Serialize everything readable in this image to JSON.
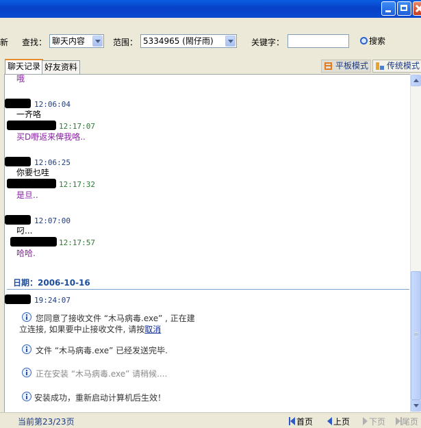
{
  "toolbar": {
    "refresh_partial": "新",
    "find_label": "查找：",
    "find_value": "聊天内容",
    "range_label": "范围：",
    "range_value": "5334965 (鬧仔雨)",
    "keyword_label": "关键字：",
    "keyword_value": "",
    "search_label": "搜索"
  },
  "tabs": [
    {
      "label": "聊天记录",
      "active": true
    },
    {
      "label": "好友资料",
      "active": false
    }
  ],
  "modes": [
    {
      "label": "平板模式",
      "active": true
    },
    {
      "label": "传统模式",
      "active": false
    }
  ],
  "messages": [
    {
      "sender": "friend",
      "time": "",
      "text": "哦"
    },
    {
      "sender": "me",
      "time": "12:06:04",
      "text": "一齐咯"
    },
    {
      "sender": "friend",
      "time": "12:17:07",
      "text": "买D嘢返来俾我咯.."
    },
    {
      "sender": "me",
      "time": "12:06:25",
      "text": "你要乜哇"
    },
    {
      "sender": "friend",
      "time": "12:17:32",
      "text": "是旦.."
    },
    {
      "sender": "me",
      "time": "12:07:00",
      "text": "叼..."
    },
    {
      "sender": "friend",
      "time": "12:17:57",
      "text": "哈哈."
    }
  ],
  "date_header": "日期：2006-10-16",
  "last_message_time": "19:24:07",
  "system_notices": [
    {
      "text_line1": "您同意了接收文件 “木马病毒.exe” , 正在建",
      "text_line2": "立连接, 如果要中止接收文件, 请按",
      "link": "取消"
    },
    {
      "text": "文件 “木马病毒.exe” 已经发送完毕."
    },
    {
      "text": "正在安装 “木马病毒.exe”  请稍候...."
    },
    {
      "text": "安装成功，重新启动计算机后生效！"
    }
  ],
  "footer": {
    "page_info": "当前第23/23页",
    "first": "首页",
    "prev": "上页",
    "next": "下页",
    "last": "尾页"
  },
  "colors": {
    "titlebar": "#0a5ee0",
    "timestamp_me": "#1b3b84",
    "timestamp_friend": "#2a7a30",
    "friend_text": "#8b1fa8",
    "date_header": "#1b4c9e",
    "tab_active_accent": "#e68b2c"
  }
}
